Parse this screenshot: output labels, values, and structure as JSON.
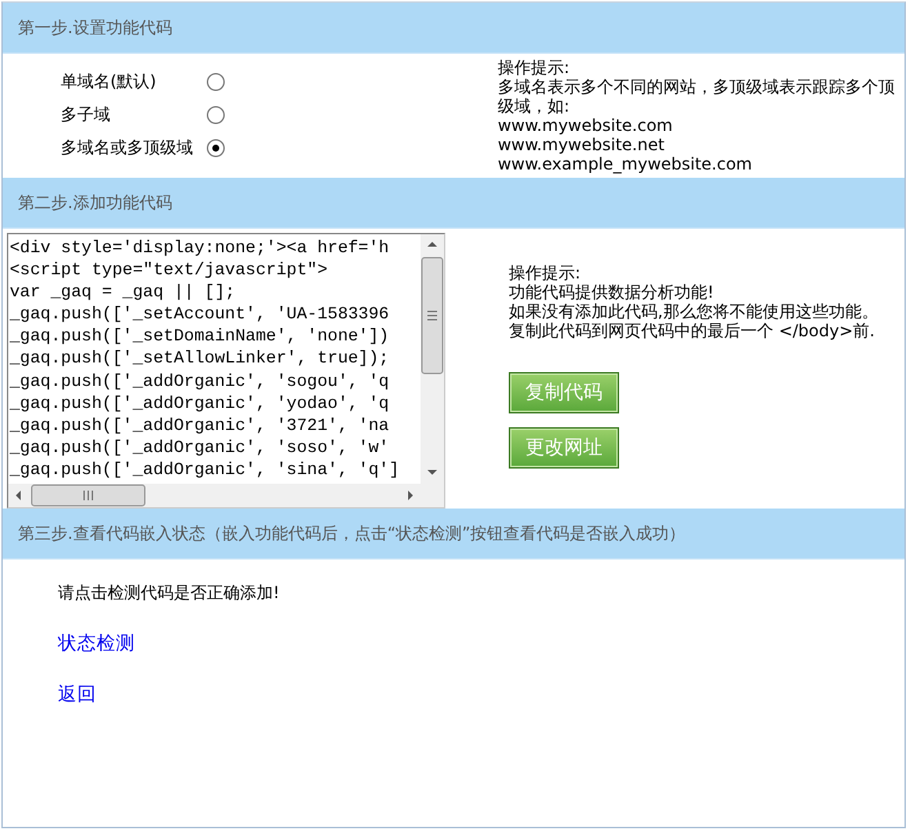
{
  "step1": {
    "title": "第一步.设置功能代码",
    "options": [
      {
        "label": "单域名(默认)",
        "selected": false
      },
      {
        "label": "多子域",
        "selected": false
      },
      {
        "label": "多域名或多顶级域",
        "selected": true
      }
    ],
    "hint": [
      "操作提示:",
      "多域名表示多个不同的网站，多顶级域表示跟踪多个顶级域，如:",
      "www.mywebsite.com",
      "www.mywebsite.net",
      "www.example_mywebsite.com"
    ]
  },
  "step2": {
    "title": "第二步.添加功能代码",
    "code_lines": [
      "<div style='display:none;'><a href='h",
      "<script type=\"text/javascript\">",
      "var _gaq = _gaq || [];",
      "_gaq.push(['_setAccount', 'UA-1583396",
      "_gaq.push(['_setDomainName', 'none'])",
      "_gaq.push(['_setAllowLinker', true]);",
      "_gaq.push(['_addOrganic', 'sogou', 'q",
      "_gaq.push(['_addOrganic', 'yodao', 'q",
      "_gaq.push(['_addOrganic', '3721', 'na",
      "_gaq.push(['_addOrganic', 'soso', 'w'",
      "_gaq.push(['_addOrganic', 'sina', 'q']"
    ],
    "hint": [
      "操作提示:",
      "功能代码提供数据分析功能!",
      "如果没有添加此代码,那么您将不能使用这些功能。",
      "复制此代码到网页代码中的最后一个 </body>前."
    ],
    "buttons": [
      "复制代码",
      "更改网址"
    ]
  },
  "step3": {
    "title": "第三步.查看代码嵌入状态（嵌入功能代码后，点击“状态检测”按钮查看代码是否嵌入成功）",
    "prompt": "请点击检测代码是否正确添加!",
    "links": [
      "状态检测",
      "返回"
    ]
  }
}
